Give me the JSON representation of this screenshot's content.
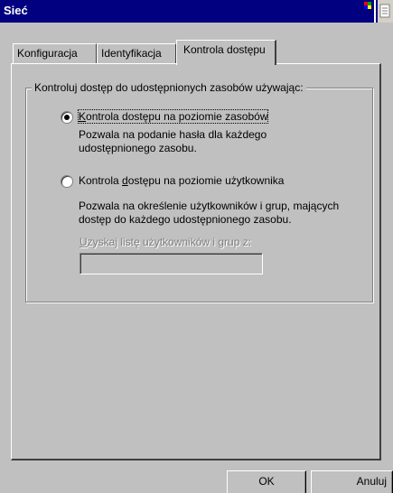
{
  "window": {
    "title": "Sieć"
  },
  "tabs": [
    {
      "label": "Konfiguracja"
    },
    {
      "label": "Identyfikacja"
    },
    {
      "label": "Kontrola dostępu"
    }
  ],
  "group": {
    "title": "Kontroluj dostęp do udostępnionych zasobów używając:"
  },
  "options": [
    {
      "label_ul": "K",
      "label_rest": "ontrola dostępu na poziomie zasobów",
      "desc1": "Pozwala na podanie hasła dla każdego",
      "desc2": "udostępnionego zasobu.",
      "selected": true
    },
    {
      "label_pre": "Kontrola ",
      "label_ul": "d",
      "label_rest": "ostępu na poziomie użytkownika",
      "desc1": "Pozwala na określenie użytkowników i grup, mających",
      "desc2": "dostęp do każdego udostępnionego zasobu.",
      "selected": false
    }
  ],
  "userlist": {
    "label_ul": "U",
    "label_rest": "zyskaj listę użytkowników i grup z:",
    "value": ""
  },
  "buttons": {
    "ok": "OK",
    "cancel": "Anuluj"
  },
  "colors": {
    "titlebar": "#000080",
    "face": "#c0c0c0",
    "disabled_text": "#808080"
  }
}
